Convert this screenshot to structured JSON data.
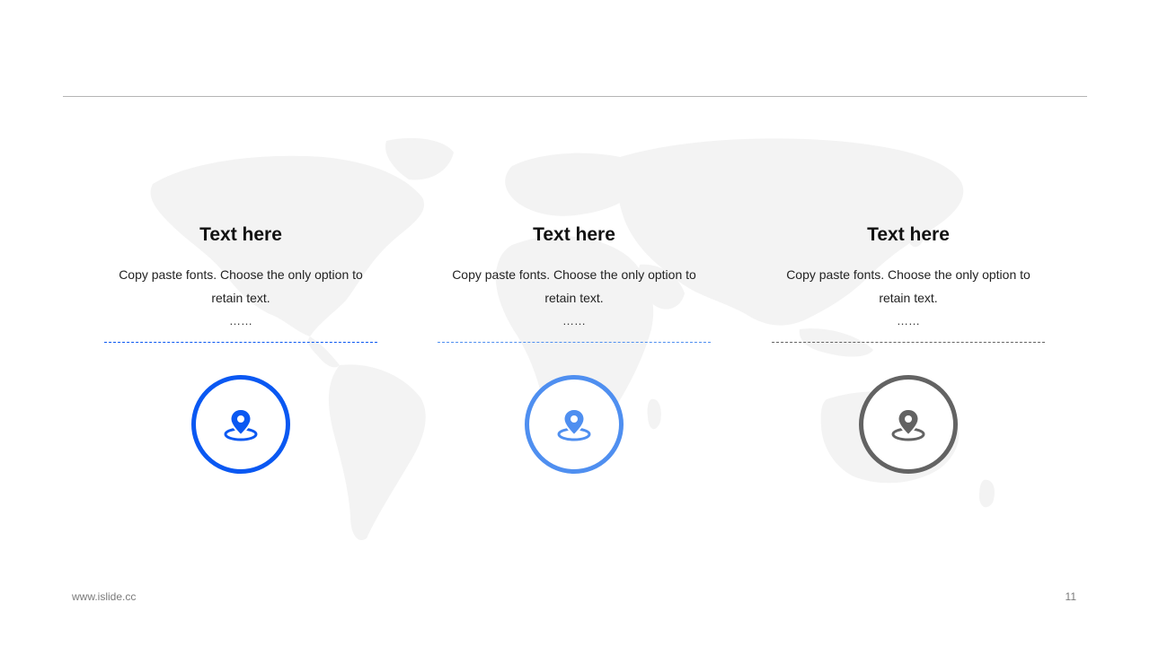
{
  "columns": [
    {
      "title": "Text here",
      "body": "Copy paste fonts. Choose the only option to retain text.",
      "ellipsis": "……",
      "color": "#0a58f2",
      "icon": "location-pin-icon"
    },
    {
      "title": "Text here",
      "body": "Copy paste fonts. Choose the only option to retain text.",
      "ellipsis": "……",
      "color": "#4f8ff0",
      "icon": "location-pin-icon"
    },
    {
      "title": "Text here",
      "body": "Copy paste fonts. Choose the only option to retain text.",
      "ellipsis": "……",
      "color": "#636363",
      "icon": "location-pin-icon"
    }
  ],
  "footer": {
    "url": "www.islide.cc",
    "page_number": "11"
  },
  "background": {
    "icon": "world-map-watermark",
    "color": "#f3f3f3"
  }
}
